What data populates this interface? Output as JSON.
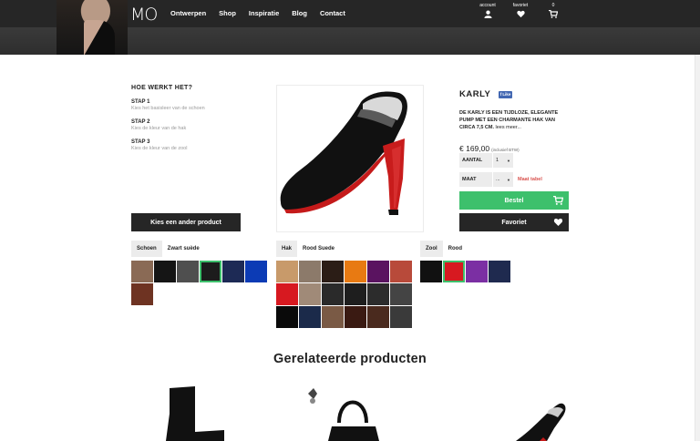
{
  "header": {
    "logo": "MO",
    "nav": [
      "Ontwerpen",
      "Shop",
      "Inspiratie",
      "Blog",
      "Contact"
    ],
    "account_label": "account",
    "favorites_label": "favoriet",
    "cart_count": "0"
  },
  "how": {
    "title": "HOE WERKT HET?",
    "steps": [
      {
        "title": "STAP 1",
        "desc": "Kies het basisleer van de schoen"
      },
      {
        "title": "STAP 2",
        "desc": "Kies de kleur van de hak"
      },
      {
        "title": "STAP 3",
        "desc": "Kies de kleur van de zool"
      }
    ],
    "other_button": "Kies een ander product"
  },
  "product": {
    "name": "KARLY",
    "fb_like": "Like",
    "description": "DE KARLY IS EEN TIJDLOZE, ELEGANTE PUMP MET EEN CHARMANTE HAK VAN CIRCA 7,5 CM.",
    "more": "lees meer...",
    "price": "€ 169,00",
    "vat": "(inclusief BTW)",
    "quantity_label": "AANTAL",
    "quantity_value": "1",
    "size_label": "MAAT",
    "size_value": "...",
    "size_chart": "Maat tabel",
    "order_button": "Bestel",
    "favorite_button": "Favoriet"
  },
  "swatches": {
    "shoe": {
      "tag": "Schoen",
      "value": "Zwart suède",
      "colors": [
        "#8a6a55",
        "#151515",
        "#4f4f4f",
        "#1c1c1c",
        "#1d2a55",
        "#0c3bb5",
        "#6e3322"
      ],
      "active": 3
    },
    "heel": {
      "tag": "Hak",
      "value": "Rood Suede",
      "colors": [
        "#c89a6a",
        "#8c7a6a",
        "#2b1d16",
        "#e87a12",
        "#5a1360",
        "#b84a3a",
        "#d71920",
        "#a08a78",
        "#2a2a2a",
        "#1e1e1e",
        "#2c2c2c",
        "#444444",
        "#0a0a0a",
        "#1b2a4a",
        "#7a5a45",
        "#3a1a12",
        "#4a2a1e",
        "#3a3a3a"
      ]
    },
    "sole": {
      "tag": "Zool",
      "value": "Rood",
      "colors": [
        "#111111",
        "#d71920",
        "#7b2fa3",
        "#1f2a4f"
      ],
      "active": 1
    }
  },
  "related": {
    "title": "Gerelateerde producten"
  }
}
